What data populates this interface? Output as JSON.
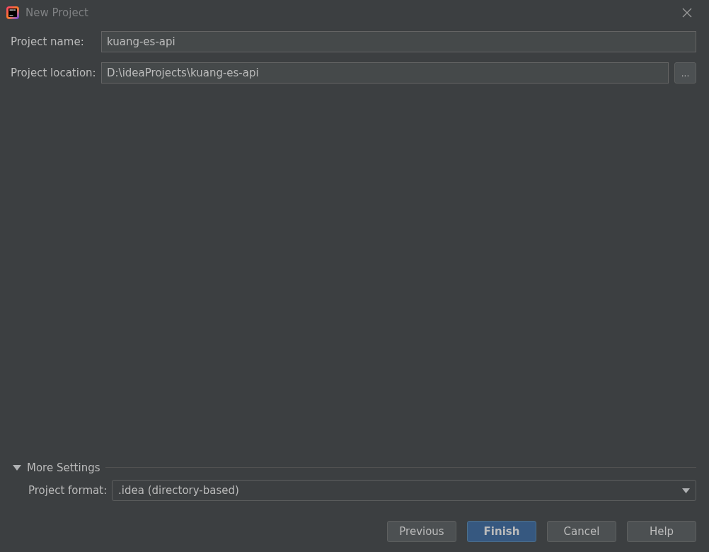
{
  "window": {
    "title": "New Project"
  },
  "fields": [
    {
      "label": "Project name:",
      "value": "kuang-es-api",
      "browse": false
    },
    {
      "label": "Project location:",
      "value": "D:\\ideaProjects\\kuang-es-api",
      "browse": true,
      "browse_label": "..."
    }
  ],
  "more_settings": {
    "title": "More Settings",
    "expanded": true,
    "format": {
      "label": "Project format:",
      "value": ".idea (directory-based)"
    }
  },
  "buttons": [
    {
      "label": "Previous",
      "primary": false
    },
    {
      "label": "Finish",
      "primary": true
    },
    {
      "label": "Cancel",
      "primary": false
    },
    {
      "label": "Help",
      "primary": false
    }
  ]
}
